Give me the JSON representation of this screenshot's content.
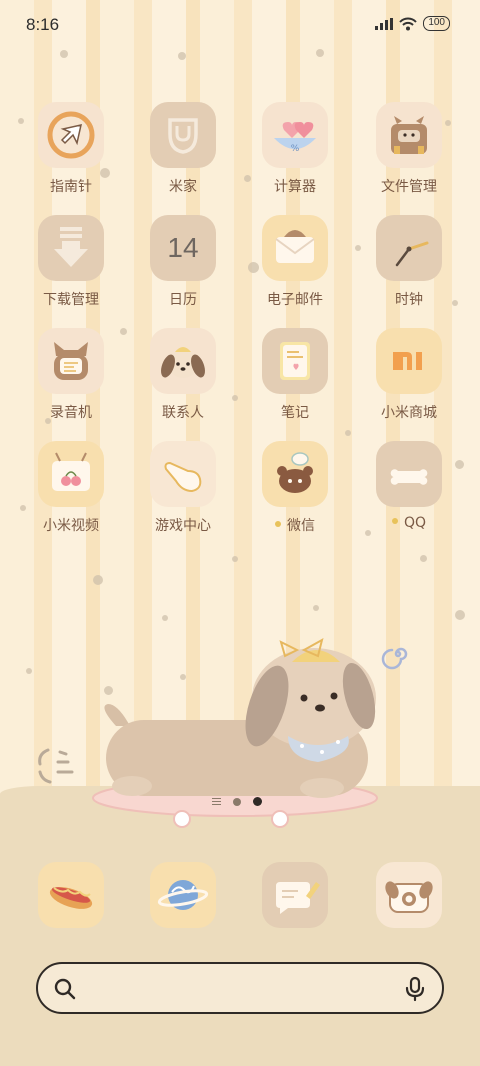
{
  "status_bar": {
    "time": "8:16",
    "battery": "100"
  },
  "apps": [
    {
      "label": "指南针",
      "icon": "compass-icon"
    },
    {
      "label": "米家",
      "icon": "mijia-icon"
    },
    {
      "label": "计算器",
      "icon": "calculator-icon"
    },
    {
      "label": "文件管理",
      "icon": "file-manager-icon"
    },
    {
      "label": "下载管理",
      "icon": "download-icon"
    },
    {
      "label": "日历",
      "icon": "calendar-icon",
      "value": "14"
    },
    {
      "label": "电子邮件",
      "icon": "email-icon"
    },
    {
      "label": "时钟",
      "icon": "clock-icon"
    },
    {
      "label": "录音机",
      "icon": "recorder-icon"
    },
    {
      "label": "联系人",
      "icon": "contacts-icon"
    },
    {
      "label": "笔记",
      "icon": "notes-icon"
    },
    {
      "label": "小米商城",
      "icon": "mi-store-icon"
    },
    {
      "label": "小米视频",
      "icon": "video-icon"
    },
    {
      "label": "游戏中心",
      "icon": "game-center-icon"
    },
    {
      "label": "微信",
      "icon": "wechat-icon",
      "new": true
    },
    {
      "label": "QQ",
      "icon": "qq-icon",
      "new": true
    }
  ],
  "dock": [
    {
      "icon": "hotdog-phone-icon"
    },
    {
      "icon": "planet-browser-icon"
    },
    {
      "icon": "message-icon"
    },
    {
      "icon": "puppy-camera-icon"
    }
  ],
  "pager": {
    "pages": 2,
    "current": 2
  },
  "colors": {
    "accent": "#e8c25a",
    "text": "#7a5a45",
    "tile_cream": "#f6e0c4",
    "tile_tan": "#e3cdb4"
  }
}
